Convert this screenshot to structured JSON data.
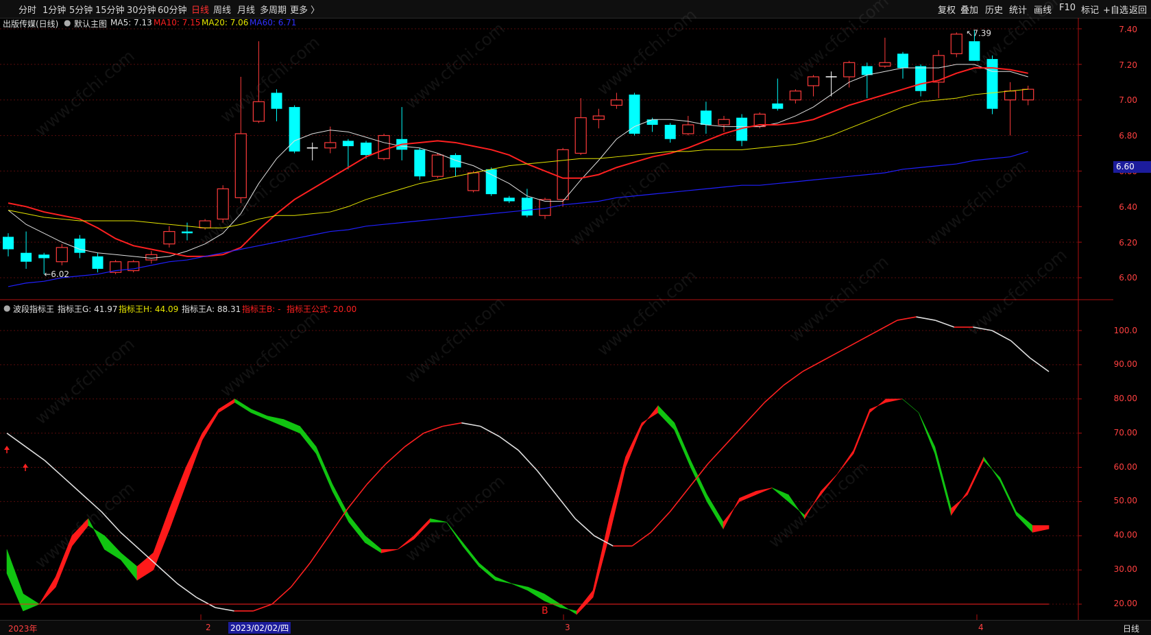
{
  "periods": [
    "分时",
    "1分钟",
    "5分钟",
    "15分钟",
    "30分钟",
    "60分钟",
    "日线",
    "周线",
    "月线",
    "多周期",
    "更多 〉"
  ],
  "active_period": "日线",
  "tools": [
    "复权",
    "叠加",
    "历史",
    "统计",
    "画线",
    "F10",
    "标记",
    "+自选",
    "返回"
  ],
  "main_header": {
    "title": "出版传媒(日线)",
    "chart_name": "默认主图",
    "ma5": "MA5: 7.13",
    "ma10": "MA10: 7.15",
    "ma20": "MA20: 7.06",
    "ma60": "MA60: 6.71"
  },
  "sub_header": {
    "title": "波段指标王",
    "g": "指标王G: 41.97",
    "h": "指标王H: 44.09",
    "a": "指标王A: 88.31",
    "b": "指标王B: -",
    "formula": "指标王公式: 20.00"
  },
  "price_axis": [
    "7.40",
    "7.20",
    "7.00",
    "6.80",
    "6.60",
    "6.40",
    "6.20",
    "6.00"
  ],
  "current_price": "6.60",
  "indicator_axis": [
    "100.0",
    "90.00",
    "80.00",
    "70.00",
    "60.00",
    "50.00",
    "40.00",
    "30.00",
    "20.00"
  ],
  "annotations": {
    "high": "7.39",
    "low": "6.02",
    "signal": "B"
  },
  "x_axis": {
    "start": "2023年",
    "m2": "2",
    "m3": "3",
    "m4": "4",
    "cursor_date": "2023/02/02/四",
    "period": "日线"
  },
  "watermark": "www.cfchi.com",
  "colors": {
    "up": "#ff3b3b",
    "down": "#00ffff",
    "ma5": "#e0e0e0",
    "ma10": "#ff2020",
    "ma20": "#e6e600",
    "ma60": "#2020ff",
    "wave_up": "#ff1a1a",
    "wave_down": "#11c411"
  },
  "chart_data": [
    {
      "type": "candlestick",
      "title": "出版传媒(日线)",
      "ylim": [
        5.9,
        7.45
      ],
      "candles": [
        {
          "o": 6.16,
          "c": 6.23,
          "h": 6.25,
          "l": 6.12,
          "dir": "down"
        },
        {
          "o": 6.14,
          "c": 6.09,
          "h": 6.26,
          "l": 6.05,
          "dir": "down"
        },
        {
          "o": 6.13,
          "c": 6.11,
          "h": 6.14,
          "l": 6.02,
          "dir": "down"
        },
        {
          "o": 6.09,
          "c": 6.17,
          "h": 6.19,
          "l": 6.07,
          "dir": "up"
        },
        {
          "o": 6.22,
          "c": 6.14,
          "h": 6.24,
          "l": 6.11,
          "dir": "down"
        },
        {
          "o": 6.12,
          "c": 6.05,
          "h": 6.14,
          "l": 6.03,
          "dir": "down"
        },
        {
          "o": 6.03,
          "c": 6.09,
          "h": 6.1,
          "l": 6.02,
          "dir": "up"
        },
        {
          "o": 6.04,
          "c": 6.09,
          "h": 6.1,
          "l": 6.03,
          "dir": "up"
        },
        {
          "o": 6.1,
          "c": 6.13,
          "h": 6.15,
          "l": 6.08,
          "dir": "up"
        },
        {
          "o": 6.19,
          "c": 6.26,
          "h": 6.29,
          "l": 6.17,
          "dir": "up"
        },
        {
          "o": 6.26,
          "c": 6.25,
          "h": 6.31,
          "l": 6.21,
          "dir": "down"
        },
        {
          "o": 6.28,
          "c": 6.32,
          "h": 6.33,
          "l": 6.27,
          "dir": "up"
        },
        {
          "o": 6.33,
          "c": 6.5,
          "h": 6.52,
          "l": 6.31,
          "dir": "up"
        },
        {
          "o": 6.45,
          "c": 6.81,
          "h": 7.13,
          "l": 6.42,
          "dir": "up"
        },
        {
          "o": 6.88,
          "c": 6.99,
          "h": 7.33,
          "l": 6.87,
          "dir": "up"
        },
        {
          "o": 7.04,
          "c": 6.95,
          "h": 7.06,
          "l": 6.88,
          "dir": "down"
        },
        {
          "o": 6.96,
          "c": 6.71,
          "h": 6.97,
          "l": 6.7,
          "dir": "down"
        },
        {
          "o": 6.73,
          "c": 6.73,
          "h": 6.76,
          "l": 6.66,
          "dir": "doji"
        },
        {
          "o": 6.73,
          "c": 6.76,
          "h": 6.85,
          "l": 6.7,
          "dir": "up"
        },
        {
          "o": 6.77,
          "c": 6.74,
          "h": 6.78,
          "l": 6.61,
          "dir": "down"
        },
        {
          "o": 6.76,
          "c": 6.69,
          "h": 6.77,
          "l": 6.67,
          "dir": "down"
        },
        {
          "o": 6.67,
          "c": 6.8,
          "h": 6.81,
          "l": 6.66,
          "dir": "up"
        },
        {
          "o": 6.78,
          "c": 6.72,
          "h": 6.96,
          "l": 6.66,
          "dir": "down"
        },
        {
          "o": 6.72,
          "c": 6.57,
          "h": 6.73,
          "l": 6.55,
          "dir": "down"
        },
        {
          "o": 6.57,
          "c": 6.69,
          "h": 6.7,
          "l": 6.56,
          "dir": "up"
        },
        {
          "o": 6.69,
          "c": 6.62,
          "h": 6.7,
          "l": 6.57,
          "dir": "down"
        },
        {
          "o": 6.49,
          "c": 6.59,
          "h": 6.6,
          "l": 6.48,
          "dir": "up"
        },
        {
          "o": 6.61,
          "c": 6.47,
          "h": 6.62,
          "l": 6.46,
          "dir": "down"
        },
        {
          "o": 6.45,
          "c": 6.43,
          "h": 6.46,
          "l": 6.42,
          "dir": "down"
        },
        {
          "o": 6.45,
          "c": 6.35,
          "h": 6.5,
          "l": 6.34,
          "dir": "down"
        },
        {
          "o": 6.35,
          "c": 6.44,
          "h": 6.45,
          "l": 6.33,
          "dir": "up"
        },
        {
          "o": 6.44,
          "c": 6.72,
          "h": 6.73,
          "l": 6.4,
          "dir": "up"
        },
        {
          "o": 6.7,
          "c": 6.9,
          "h": 7.01,
          "l": 6.69,
          "dir": "up"
        },
        {
          "o": 6.89,
          "c": 6.91,
          "h": 6.95,
          "l": 6.84,
          "dir": "up"
        },
        {
          "o": 6.97,
          "c": 7.0,
          "h": 7.04,
          "l": 6.95,
          "dir": "up"
        },
        {
          "o": 7.03,
          "c": 6.81,
          "h": 7.04,
          "l": 6.8,
          "dir": "down"
        },
        {
          "o": 6.89,
          "c": 6.86,
          "h": 6.9,
          "l": 6.82,
          "dir": "down"
        },
        {
          "o": 6.86,
          "c": 6.78,
          "h": 6.87,
          "l": 6.76,
          "dir": "down"
        },
        {
          "o": 6.81,
          "c": 6.86,
          "h": 6.91,
          "l": 6.8,
          "dir": "up"
        },
        {
          "o": 6.94,
          "c": 6.86,
          "h": 6.99,
          "l": 6.81,
          "dir": "down"
        },
        {
          "o": 6.86,
          "c": 6.89,
          "h": 6.91,
          "l": 6.82,
          "dir": "up"
        },
        {
          "o": 6.9,
          "c": 6.77,
          "h": 6.92,
          "l": 6.74,
          "dir": "down"
        },
        {
          "o": 6.85,
          "c": 6.92,
          "h": 6.93,
          "l": 6.84,
          "dir": "up"
        },
        {
          "o": 6.98,
          "c": 6.95,
          "h": 7.12,
          "l": 6.94,
          "dir": "down"
        },
        {
          "o": 7.0,
          "c": 7.05,
          "h": 7.06,
          "l": 6.98,
          "dir": "up"
        },
        {
          "o": 7.08,
          "c": 7.13,
          "h": 7.14,
          "l": 7.02,
          "dir": "up"
        },
        {
          "o": 7.13,
          "c": 7.13,
          "h": 7.16,
          "l": 7.02,
          "dir": "doji"
        },
        {
          "o": 7.13,
          "c": 7.21,
          "h": 7.22,
          "l": 7.07,
          "dir": "up"
        },
        {
          "o": 7.19,
          "c": 7.14,
          "h": 7.21,
          "l": 7.01,
          "dir": "down"
        },
        {
          "o": 7.19,
          "c": 7.21,
          "h": 7.35,
          "l": 7.18,
          "dir": "up"
        },
        {
          "o": 7.26,
          "c": 7.18,
          "h": 7.27,
          "l": 7.12,
          "dir": "down"
        },
        {
          "o": 7.19,
          "c": 7.05,
          "h": 7.2,
          "l": 7.02,
          "dir": "down"
        },
        {
          "o": 7.1,
          "c": 7.25,
          "h": 7.28,
          "l": 7.01,
          "dir": "up"
        },
        {
          "o": 7.26,
          "c": 7.37,
          "h": 7.38,
          "l": 7.24,
          "dir": "up"
        },
        {
          "o": 7.33,
          "c": 7.22,
          "h": 7.39,
          "l": 7.22,
          "dir": "down"
        },
        {
          "o": 7.23,
          "c": 6.95,
          "h": 7.25,
          "l": 6.92,
          "dir": "down"
        },
        {
          "o": 7.0,
          "c": 7.05,
          "h": 7.1,
          "l": 6.8,
          "dir": "up"
        },
        {
          "o": 7.0,
          "c": 7.06,
          "h": 7.08,
          "l": 6.97,
          "dir": "up"
        }
      ],
      "series": [
        {
          "name": "MA5",
          "values": [
            6.38,
            6.3,
            6.25,
            6.2,
            6.16,
            6.14,
            6.13,
            6.12,
            6.11,
            6.12,
            6.15,
            6.19,
            6.25,
            6.36,
            6.53,
            6.67,
            6.77,
            6.81,
            6.83,
            6.82,
            6.79,
            6.76,
            6.74,
            6.73,
            6.7,
            6.66,
            6.63,
            6.58,
            6.53,
            6.46,
            6.43,
            6.43,
            6.55,
            6.66,
            6.78,
            6.85,
            6.89,
            6.89,
            6.88,
            6.86,
            6.85,
            6.85,
            6.85,
            6.87,
            6.91,
            6.96,
            7.03,
            7.1,
            7.14,
            7.16,
            7.18,
            7.18,
            7.18,
            7.2,
            7.2,
            7.16,
            7.16,
            7.13
          ]
        },
        {
          "name": "MA10",
          "values": [
            6.42,
            6.4,
            6.37,
            6.35,
            6.33,
            6.28,
            6.22,
            6.18,
            6.16,
            6.14,
            6.12,
            6.12,
            6.13,
            6.17,
            6.27,
            6.36,
            6.44,
            6.5,
            6.56,
            6.62,
            6.68,
            6.72,
            6.75,
            6.76,
            6.77,
            6.76,
            6.74,
            6.72,
            6.69,
            6.64,
            6.6,
            6.56,
            6.56,
            6.58,
            6.62,
            6.65,
            6.68,
            6.7,
            6.73,
            6.77,
            6.81,
            6.84,
            6.86,
            6.86,
            6.87,
            6.89,
            6.93,
            6.97,
            7.0,
            7.03,
            7.06,
            7.09,
            7.11,
            7.15,
            7.18,
            7.18,
            7.17,
            7.15
          ]
        },
        {
          "name": "MA20",
          "values": [
            6.38,
            6.36,
            6.34,
            6.33,
            6.32,
            6.32,
            6.32,
            6.32,
            6.31,
            6.3,
            6.29,
            6.28,
            6.28,
            6.3,
            6.33,
            6.35,
            6.35,
            6.36,
            6.37,
            6.4,
            6.44,
            6.47,
            6.5,
            6.53,
            6.55,
            6.57,
            6.59,
            6.61,
            6.63,
            6.64,
            6.65,
            6.66,
            6.67,
            6.67,
            6.68,
            6.69,
            6.7,
            6.71,
            6.71,
            6.72,
            6.72,
            6.72,
            6.73,
            6.74,
            6.75,
            6.77,
            6.8,
            6.84,
            6.88,
            6.92,
            6.96,
            6.99,
            7.0,
            7.01,
            7.03,
            7.04,
            7.05,
            7.06
          ]
        },
        {
          "name": "MA60",
          "values": [
            5.95,
            5.97,
            5.98,
            6.0,
            6.01,
            6.02,
            6.04,
            6.05,
            6.07,
            6.09,
            6.1,
            6.12,
            6.14,
            6.16,
            6.18,
            6.2,
            6.22,
            6.24,
            6.26,
            6.27,
            6.29,
            6.3,
            6.31,
            6.32,
            6.33,
            6.34,
            6.35,
            6.36,
            6.37,
            6.38,
            6.39,
            6.41,
            6.42,
            6.43,
            6.45,
            6.46,
            6.47,
            6.48,
            6.49,
            6.5,
            6.51,
            6.52,
            6.52,
            6.53,
            6.54,
            6.55,
            6.56,
            6.57,
            6.58,
            6.59,
            6.61,
            6.62,
            6.63,
            6.64,
            6.66,
            6.67,
            6.68,
            6.71
          ]
        }
      ]
    },
    {
      "type": "area",
      "title": "波段指标王",
      "ylim": [
        16,
        107
      ],
      "x_index_count": 58,
      "series": [
        {
          "name": "指标王G",
          "values": [
            36,
            23,
            20,
            25,
            37,
            43,
            40,
            35,
            31,
            35,
            48,
            60,
            70,
            77,
            80,
            77,
            75,
            74,
            72,
            66,
            55,
            46,
            40,
            36,
            36,
            39,
            44,
            44,
            38,
            32,
            28,
            26,
            25,
            23,
            20,
            17,
            22,
            40,
            60,
            72,
            78,
            73,
            62,
            52,
            44,
            50,
            52,
            54,
            50,
            46,
            52,
            58,
            64,
            76,
            80,
            80,
            76,
            66,
            48,
            52,
            62,
            57,
            47,
            43,
            43
          ]
        },
        {
          "name": "指标王H",
          "values": [
            29,
            18,
            20,
            28,
            40,
            45,
            36,
            33,
            27,
            30,
            42,
            55,
            68,
            76,
            79,
            76,
            74,
            72,
            70,
            64,
            53,
            44,
            38,
            35,
            36,
            40,
            45,
            44,
            37,
            31,
            27,
            26,
            24,
            21,
            19,
            18,
            24,
            45,
            63,
            73,
            76,
            71,
            60,
            50,
            42,
            51,
            53,
            54,
            52,
            45,
            53,
            58,
            65,
            77,
            79,
            80,
            76,
            64,
            46,
            53,
            63,
            56,
            46,
            41,
            42
          ]
        },
        {
          "name": "指标王A",
          "values": [
            70,
            66,
            62,
            57,
            52,
            47,
            41,
            36,
            31,
            26,
            22,
            19,
            18,
            18,
            20,
            25,
            32,
            40,
            48,
            55,
            61,
            66,
            70,
            72,
            73,
            72,
            69,
            65,
            59,
            52,
            45,
            40,
            37,
            37,
            41,
            47,
            54,
            61,
            67,
            73,
            79,
            84,
            88,
            91,
            94,
            97,
            100,
            103,
            104,
            103,
            101,
            101,
            100,
            97,
            92,
            88
          ]
        },
        {
          "name": "指标王公式",
          "values": [
            20
          ]
        }
      ]
    }
  ]
}
